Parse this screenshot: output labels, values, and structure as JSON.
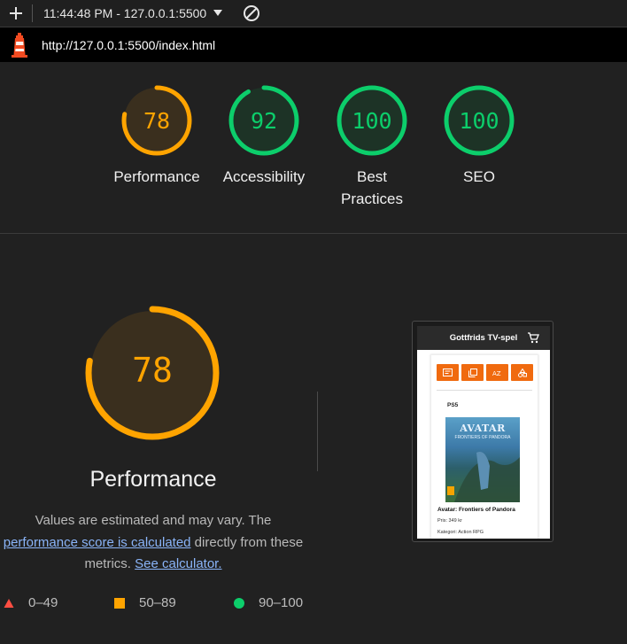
{
  "toolbar": {
    "report_label": "11:44:48 PM - 127.0.0.1:5500"
  },
  "urlbar": {
    "url": "http://127.0.0.1:5500/index.html"
  },
  "scores": [
    {
      "value": 78,
      "label": "Performance",
      "color": "#ffa400",
      "fill": "#3a2f1e"
    },
    {
      "value": 92,
      "label": "Accessibility",
      "color": "#0cce6b",
      "fill": "#1d3326"
    },
    {
      "value": 100,
      "label": "Best Practices",
      "color": "#0cce6b",
      "fill": "#1d3326"
    },
    {
      "value": 100,
      "label": "SEO",
      "color": "#0cce6b",
      "fill": "#1d3326"
    }
  ],
  "main": {
    "score": 78,
    "title": "Performance",
    "desc_part1": "Values are estimated and may vary. The",
    "desc_link1": "performance score is calculated",
    "desc_part2": " directly from these metrics. ",
    "desc_link2": "See calculator."
  },
  "legend": [
    {
      "range": "0–49",
      "color": "#ff4e42",
      "shape": "triangle"
    },
    {
      "range": "50–89",
      "color": "#ffa400",
      "shape": "square"
    },
    {
      "range": "90–100",
      "color": "#0cce6b",
      "shape": "circle"
    }
  ],
  "thumbnail": {
    "site_title": "Gottfrids TV-spel",
    "platform": "PS5",
    "cover_title": "AVATAR",
    "cover_subtitle": "FRONTIERS OF PANDORA",
    "product_name": "Avatar: Frontiers of Pandora",
    "price": "Pris: 349 kr",
    "category": "Kategori: Action RPG"
  }
}
